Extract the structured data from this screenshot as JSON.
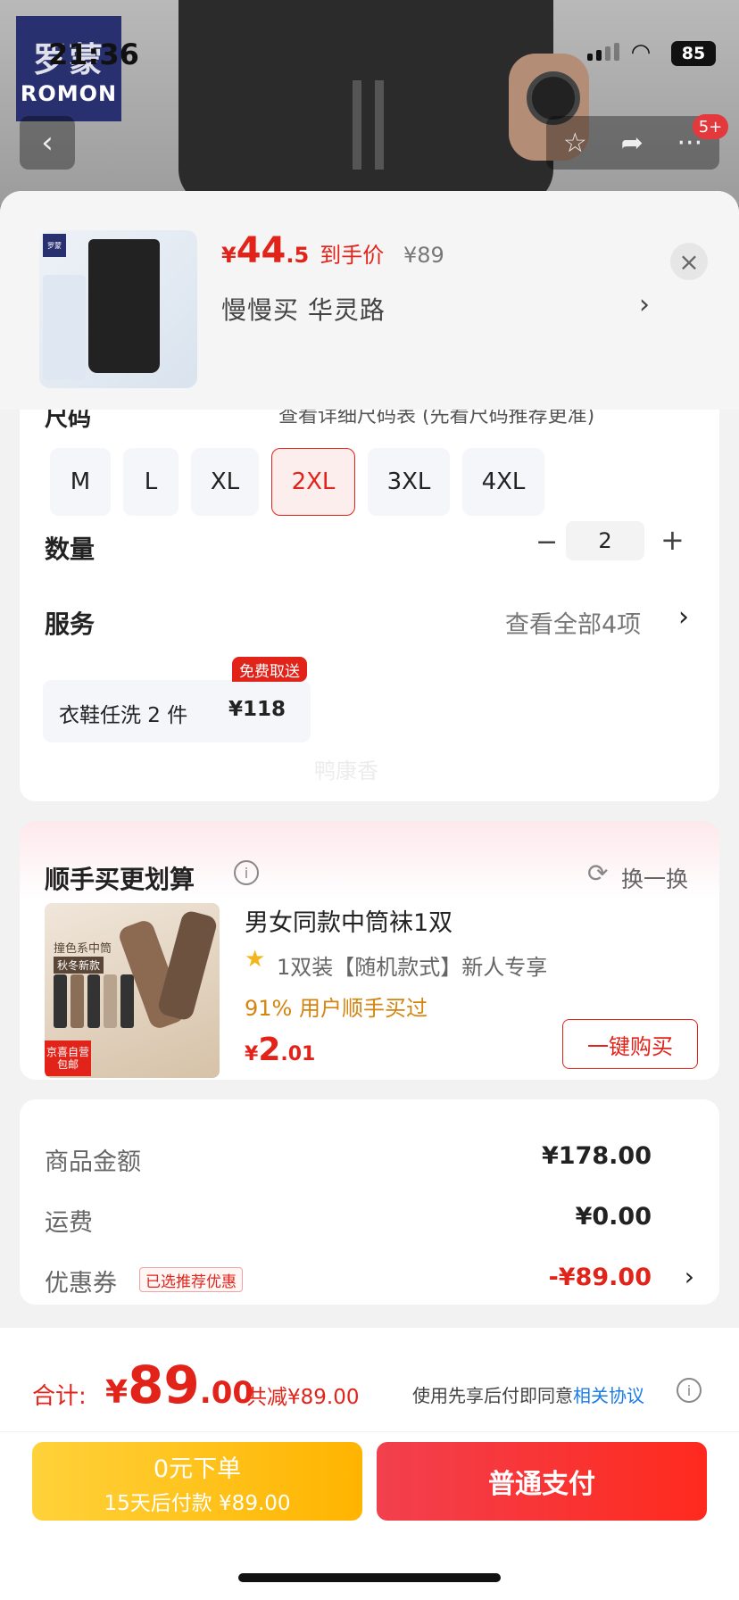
{
  "status_bar": {
    "time": "21:36",
    "battery": "85"
  },
  "background": {
    "brand_logo": {
      "cn": "罗蒙",
      "en": "ROMON"
    },
    "message_badge": "5+",
    "icons": {
      "back": "back-arrow-icon",
      "favorite": "star-icon",
      "share": "share-icon",
      "more": "more-icon"
    }
  },
  "sheet": {
    "price": {
      "symbol": "¥",
      "integer": "44",
      "decimal": ".5",
      "tag": "到手价",
      "original": "¥89"
    },
    "variant": "慢慢买  华灵路",
    "size_section": {
      "label": "尺码",
      "hint": "查看详细尺码表 (先看尺码推荐更准)",
      "sizes": [
        "M",
        "L",
        "XL",
        "2XL",
        "3XL",
        "4XL"
      ],
      "selected": "2XL"
    },
    "quantity": {
      "label": "数量",
      "value": "2"
    },
    "service": {
      "label": "服务",
      "view_all": "查看全部4项",
      "item": {
        "name": "衣鞋任洗 2 件",
        "price": "¥118",
        "badge": "免费取送"
      },
      "watermark": "鸭康香"
    },
    "addon": {
      "title": "顺手买更划算",
      "refresh": "换一换",
      "product": {
        "name": "男女同款中筒袜1双",
        "desc": "1双装【随机款式】新人专享",
        "purchase_rate": "91% 用户顺手买过",
        "price_symbol": "¥",
        "price_int": "2",
        "price_dec": ".01",
        "button": "一键购买",
        "image_caption": "撞色系中筒",
        "image_sub": "秋冬新款",
        "image_jd": "京喜自营",
        "image_ship": "包邮"
      }
    },
    "summary": {
      "rows": [
        {
          "key": "商品金额",
          "value": "¥178.00"
        },
        {
          "key": "运费",
          "value": "¥0.00"
        },
        {
          "key": "优惠券",
          "value": "-¥89.00",
          "tag": "已选推荐优惠"
        }
      ]
    }
  },
  "bottom_bar": {
    "total_label": "合计:",
    "total_symbol": "¥",
    "total_int": "89",
    "total_dec": ".00",
    "total_save": "共减¥89.00",
    "agree_text": "使用先享后付即同意",
    "agree_link": "相关协议",
    "later_line1": "0元下单",
    "later_line2": "15天后付款 ¥89.00",
    "pay_button": "普通支付"
  },
  "colors": {
    "accent_red": "#e2231a",
    "later_yellow": "#ffc21a",
    "link_blue": "#1a7ce6"
  }
}
